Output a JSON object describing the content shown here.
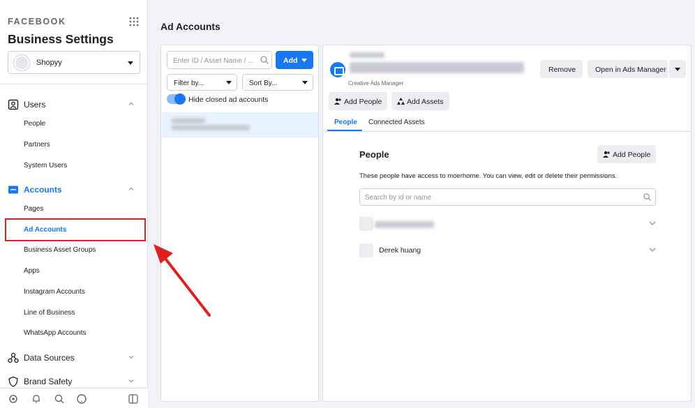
{
  "sidebar": {
    "brand": "FACEBOOK",
    "title": "Business Settings",
    "business_selector": "Shopyy",
    "sections": {
      "users": {
        "label": "Users",
        "items": [
          "People",
          "Partners",
          "System Users"
        ]
      },
      "accounts": {
        "label": "Accounts",
        "items": [
          "Pages",
          "Ad Accounts",
          "Business Asset Groups",
          "Apps",
          "Instagram Accounts",
          "Line of Business",
          "WhatsApp Accounts"
        ]
      },
      "data_sources": {
        "label": "Data Sources"
      },
      "brand_safety": {
        "label": "Brand Safety"
      }
    },
    "selected_item": "Ad Accounts"
  },
  "main": {
    "title": "Ad Accounts"
  },
  "list_panel": {
    "search_placeholder": "Enter ID / Asset Name / ...",
    "add_label": "Add",
    "filter_label": "Filter by...",
    "sort_label": "Sort By...",
    "toggle_label": "Hide closed ad accounts",
    "toggle_on": true
  },
  "detail_panel": {
    "account_subtitle": "Creative Ads Manager",
    "remove_label": "Remove",
    "open_ads_manager_label": "Open in Ads Manager",
    "add_people_label": "Add People",
    "add_assets_label": "Add Assets",
    "tabs": [
      "People",
      "Connected Assets"
    ],
    "active_tab": "People",
    "people": {
      "heading": "People",
      "add_people_label": "Add People",
      "description": "These people have access to moerhome. You can view, edit or delete their permissions.",
      "search_placeholder": "Search by id or name",
      "rows": [
        "",
        "Derek huang"
      ]
    }
  },
  "colors": {
    "accent": "#1877f2",
    "highlight_border": "#e02020",
    "arrow": "#e02020"
  }
}
